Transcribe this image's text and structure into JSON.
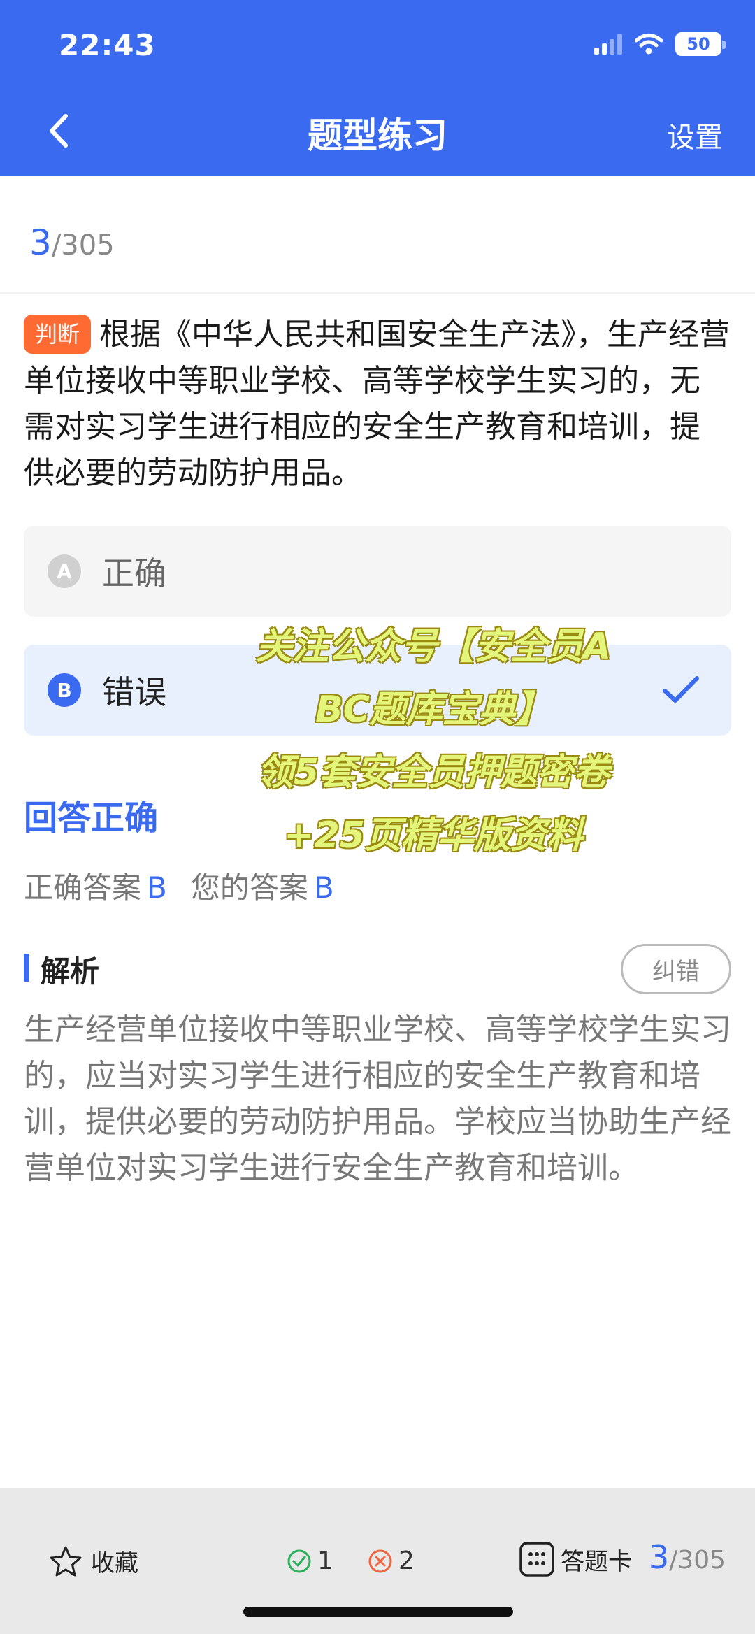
{
  "status_bar": {
    "time": "22:43",
    "battery": "50"
  },
  "nav": {
    "title": "题型练习",
    "settings_label": "设置"
  },
  "progress": {
    "current": "3",
    "total": "/305"
  },
  "question": {
    "type_tag": "判断",
    "text": "根据《中华人民共和国安全生产法》，生产经营单位接收中等职业学校、高等学校学生实习的，无需对实习学生进行相应的安全生产教育和培训，提供必要的劳动防护用品。"
  },
  "options": [
    {
      "letter": "A",
      "text": "正确",
      "selected": false
    },
    {
      "letter": "B",
      "text": "错误",
      "selected": true
    }
  ],
  "result": {
    "status": "回答正确",
    "correct_label": "正确答案",
    "correct_value": "B",
    "yours_label": "您的答案",
    "yours_value": "B"
  },
  "analysis": {
    "title": "解析",
    "report_label": "纠错",
    "text": "生产经营单位接收中等职业学校、高等学校学生实习的，应当对实习学生进行相应的安全生产教育和培训，提供必要的劳动防护用品。学校应当协助生产经营单位对实习学生进行安全生产教育和培训。"
  },
  "watermark": {
    "line1": "关注公众号【安全员A",
    "line2": "BC题库宝典】",
    "line3": "领5套安全员押题密卷",
    "line4": "+25页精华版资料"
  },
  "bottom_bar": {
    "favorite_label": "收藏",
    "correct_count": "1",
    "wrong_count": "2",
    "answer_card_label": "答题卡",
    "current": "3",
    "total": "/305"
  },
  "colors": {
    "primary": "#3a6af0",
    "tag": "#ff6a33",
    "correct": "#2bb15a",
    "wrong": "#f0653f"
  }
}
